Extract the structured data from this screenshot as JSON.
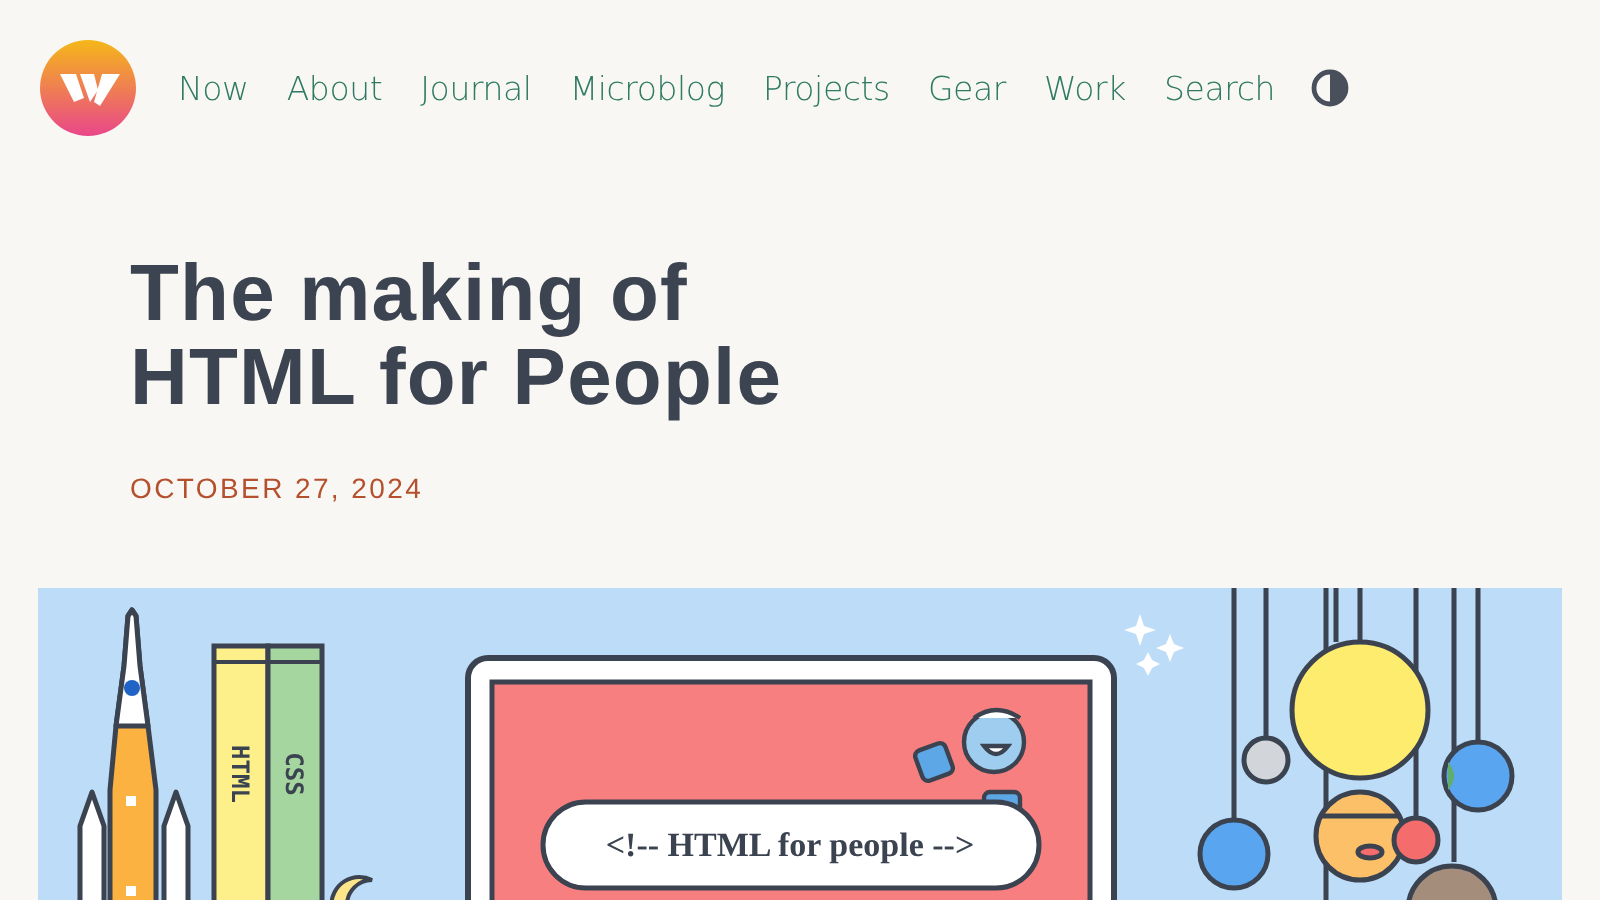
{
  "header": {
    "nav": [
      {
        "label": "Now"
      },
      {
        "label": "About"
      },
      {
        "label": "Journal"
      },
      {
        "label": "Microblog"
      },
      {
        "label": "Projects"
      },
      {
        "label": "Gear"
      },
      {
        "label": "Work"
      },
      {
        "label": "Search"
      }
    ]
  },
  "article": {
    "title": "The making of HTML for People",
    "date": "OCTOBER 27, 2024",
    "hero": {
      "book_labels": [
        "HTML",
        "CSS"
      ],
      "bubble_text": "<!-- HTML for people -->"
    }
  }
}
